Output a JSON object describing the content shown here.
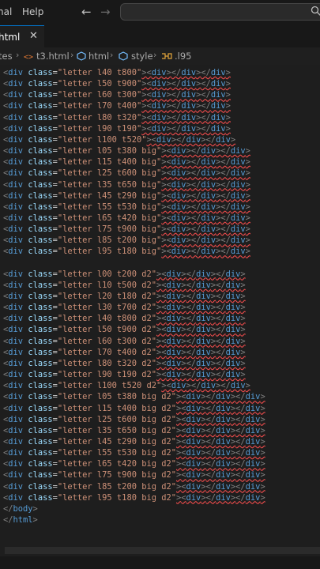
{
  "menu": {
    "item1": "nal",
    "item2": "Help"
  },
  "tab": {
    "label": "html",
    "close": "✕"
  },
  "breadcrumb": {
    "seg1": "tes",
    "sep": "›",
    "seg2": "t3.html",
    "seg3": "html",
    "seg4": "style",
    "seg5": ".l95"
  },
  "code_lines": [
    "<div class=\"letter l40 t800\"><div></div></div>",
    "<div class=\"letter l50 t900\"><div></div></div>",
    "<div class=\"letter l60 t300\"><div></div></div>",
    "<div class=\"letter l70 t400\"><div></div></div>",
    "<div class=\"letter l80 t320\"><div></div></div>",
    "<div class=\"letter l90 t190\"><div></div></div>",
    "<div class=\"letter l100 t520\"><div></div></div>",
    "<div class=\"letter l05 t380 big\"><div></div></div>",
    "<div class=\"letter l15 t400 big\"><div></div></div>",
    "<div class=\"letter l25 t600 big\"><div></div></div>",
    "<div class=\"letter l35 t650 big\"><div></div></div>",
    "<div class=\"letter l45 t290 big\"><div></div></div>",
    "<div class=\"letter l55 t530 big\"><div></div></div>",
    "<div class=\"letter l65 t420 big\"><div></div></div>",
    "<div class=\"letter l75 t900 big\"><div></div></div>",
    "<div class=\"letter l85 t200 big\"><div></div></div>",
    "<div class=\"letter l95 t180 big\"><div></div></div>",
    "",
    "<div class=\"letter l00 t200 d2\"><div></div></div>",
    "<div class=\"letter l10 t500 d2\"><div></div></div>",
    "<div class=\"letter l20 t180 d2\"><div></div></div>",
    "<div class=\"letter l30 t700 d2\"><div></div></div>",
    "<div class=\"letter l40 t800 d2\"><div></div></div>",
    "<div class=\"letter l50 t900 d2\"><div></div></div>",
    "<div class=\"letter l60 t300 d2\"><div></div></div>",
    "<div class=\"letter l70 t400 d2\"><div></div></div>",
    "<div class=\"letter l80 t320 d2\"><div></div></div>",
    "<div class=\"letter l90 t190 d2\"><div></div></div>",
    "<div class=\"letter l100 t520 d2\"><div></div></div>",
    "<div class=\"letter l05 t380 big d2\"><div></div></div>",
    "<div class=\"letter l15 t400 big d2\"><div></div></div>",
    "<div class=\"letter l25 t600 big d2\"><div></div></div>",
    "<div class=\"letter l35 t650 big d2\"><div></div></div>",
    "<div class=\"letter l45 t290 big d2\"><div></div></div>",
    "<div class=\"letter l55 t530 big d2\"><div></div></div>",
    "<div class=\"letter l65 t420 big d2\"><div></div></div>",
    "<div class=\"letter l75 t900 big d2\"><div></div></div>",
    "<div class=\"letter l85 t200 big d2\"><div></div></div>",
    "<div class=\"letter l95 t180 big d2\"><div></div></div>",
    "</body>",
    "</html>"
  ],
  "colors": {
    "tag": "#569cd6",
    "attr": "#9cdcfe",
    "string": "#ce9178",
    "error_underline": "#f14c4c",
    "background": "#1e1e1e"
  }
}
